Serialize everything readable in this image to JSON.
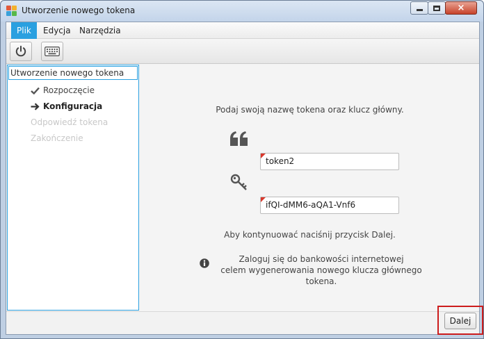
{
  "window": {
    "title": "Utworzenie nowego tokena",
    "close_glyph": "×"
  },
  "menu": {
    "items": [
      {
        "label": "Plik",
        "active": true
      },
      {
        "label": "Edycja",
        "active": false
      },
      {
        "label": "Narzędzia",
        "active": false
      }
    ]
  },
  "toolbar": {
    "buttons": [
      {
        "icon": "power-icon"
      },
      {
        "icon": "keyboard-icon"
      }
    ]
  },
  "wizard": {
    "header": "Utworzenie nowego tokena",
    "steps": [
      {
        "label": "Rozpoczęcie",
        "state": "done",
        "marker": "check-icon"
      },
      {
        "label": "Konfiguracja",
        "state": "current",
        "marker": "arrow-right-icon"
      },
      {
        "label": "Odpowiedź tokena",
        "state": "pending"
      },
      {
        "label": "Zakończenie",
        "state": "pending"
      }
    ]
  },
  "form": {
    "prompt": "Podaj swoją nazwę tokena oraz klucz główny.",
    "name_field": {
      "value": "token2",
      "icon": "quote-icon"
    },
    "key_field": {
      "value": "ifQI-dMM6-aQA1-Vnf6",
      "icon": "key-icon"
    },
    "continue_note": "Aby kontynuować naciśnij przycisk Dalej.",
    "info_line1": "Zaloguj się do bankowości internetowej",
    "info_line2": "celem wygenerowania nowego klucza głównego tokena.",
    "info_icon": "info-icon"
  },
  "footer": {
    "next_label": "Dalej"
  },
  "colors": {
    "accent": "#2aa0e0",
    "highlight": "#cc1c1c",
    "required_marker": "#d9372b"
  }
}
